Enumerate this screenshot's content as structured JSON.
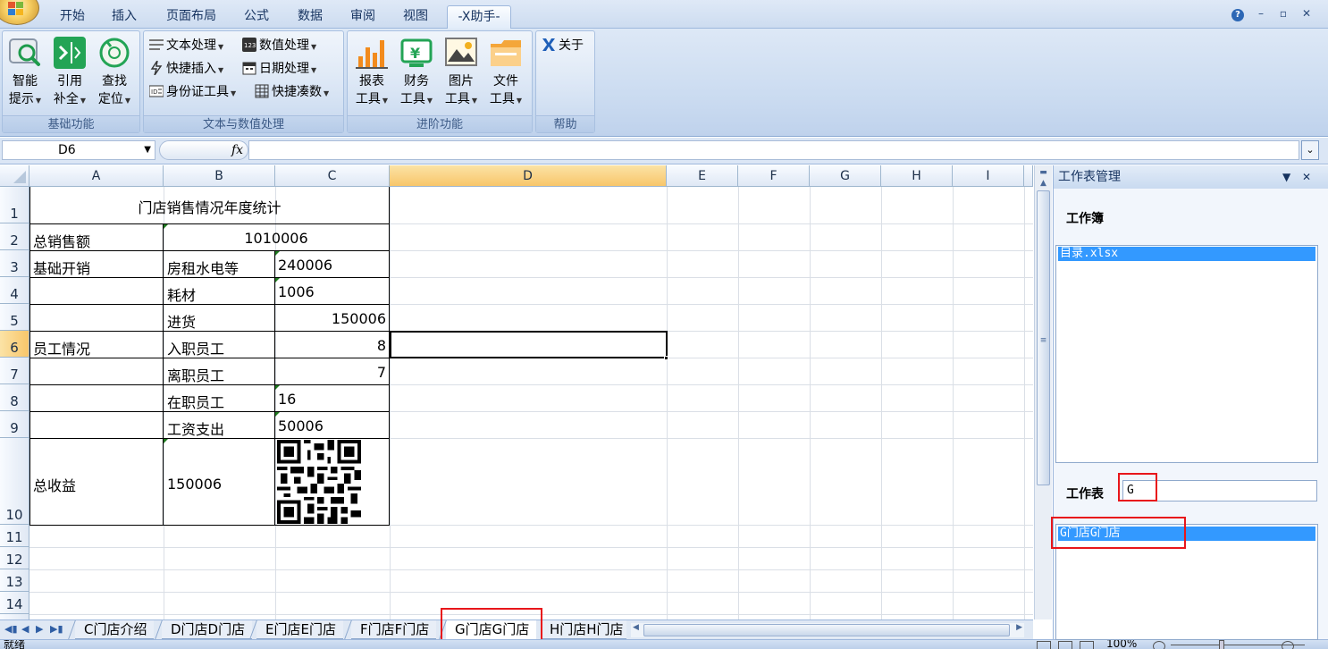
{
  "ribbon_tabs": [
    "开始",
    "插入",
    "页面布局",
    "公式",
    "数据",
    "审阅",
    "视图",
    "-X助手-"
  ],
  "active_tab": "-X助手-",
  "window_controls": {
    "help": "?",
    "minimize": "–",
    "restore": "▫",
    "close": "✕"
  },
  "ribbon": {
    "group_basic": {
      "label": "基础功能",
      "buttons": [
        {
          "line1": "智能",
          "line2": "提示",
          "icon": "search-icon"
        },
        {
          "line1": "引用",
          "line2": "补全",
          "icon": "insert-reference-icon"
        },
        {
          "line1": "查找",
          "line2": "定位",
          "icon": "locate-icon"
        }
      ]
    },
    "group_text": {
      "label": "文本与数值处理",
      "buttons": [
        {
          "label": "文本处理",
          "icon": "text-lines-icon"
        },
        {
          "label": "数值处理",
          "icon": "number-123-icon"
        },
        {
          "label": "快捷插入",
          "icon": "lightning-icon"
        },
        {
          "label": "日期处理",
          "icon": "calendar-icon"
        },
        {
          "label": "身份证工具",
          "icon": "id-card-icon"
        },
        {
          "label": "快捷凑数",
          "icon": "grid-icon"
        }
      ]
    },
    "group_advanced": {
      "label": "进阶功能",
      "buttons": [
        {
          "line1": "报表",
          "line2": "工具",
          "icon": "bar-chart-icon"
        },
        {
          "line1": "财务",
          "line2": "工具",
          "icon": "finance-yen-icon"
        },
        {
          "line1": "图片",
          "line2": "工具",
          "icon": "picture-icon"
        },
        {
          "line1": "文件",
          "line2": "工具",
          "icon": "folder-icon"
        }
      ]
    },
    "group_help": {
      "label": "帮助",
      "buttons": [
        {
          "label": "关于",
          "icon": "x-logo-icon"
        }
      ]
    }
  },
  "formula_bar": {
    "name_box": "D6",
    "fx": "fx",
    "formula": ""
  },
  "columns": [
    "A",
    "B",
    "C",
    "D",
    "E",
    "F",
    "G",
    "H",
    "I"
  ],
  "rows": [
    "1",
    "2",
    "3",
    "4",
    "5",
    "6",
    "7",
    "8",
    "9",
    "10",
    "11",
    "12",
    "13",
    "14"
  ],
  "cells": {
    "A1": "门店销售情况年度统计",
    "A2": "总销售额",
    "B2": "1010006",
    "A3": "基础开销",
    "B3": "房租水电等",
    "C3": "240006",
    "B4": "耗材",
    "C4": "1006",
    "B5": "进货",
    "C5": "150006",
    "A6": "员工情况",
    "B6": "入职员工",
    "C6": "8",
    "B7": "离职员工",
    "C7": "7",
    "B8": "在职员工",
    "C8": "16",
    "B9": "工资支出",
    "C9": "50006",
    "A10": "总收益",
    "B10": "150006"
  },
  "sheet_tabs": [
    "C门店介绍",
    "D门店D门店",
    "E门店E门店",
    "F门店F门店",
    "G门店G门店",
    "H门店H门店"
  ],
  "active_sheet": "G门店G门店",
  "status": {
    "ready": "就绪",
    "zoom": "100%"
  },
  "task_pane": {
    "title": "工作表管理",
    "workbook_label": "工作簿",
    "workbook_items": [
      "目录.xlsx"
    ],
    "sheet_label": "工作表",
    "sheet_filter": "G",
    "sheet_items": [
      "G门店G门店"
    ]
  }
}
